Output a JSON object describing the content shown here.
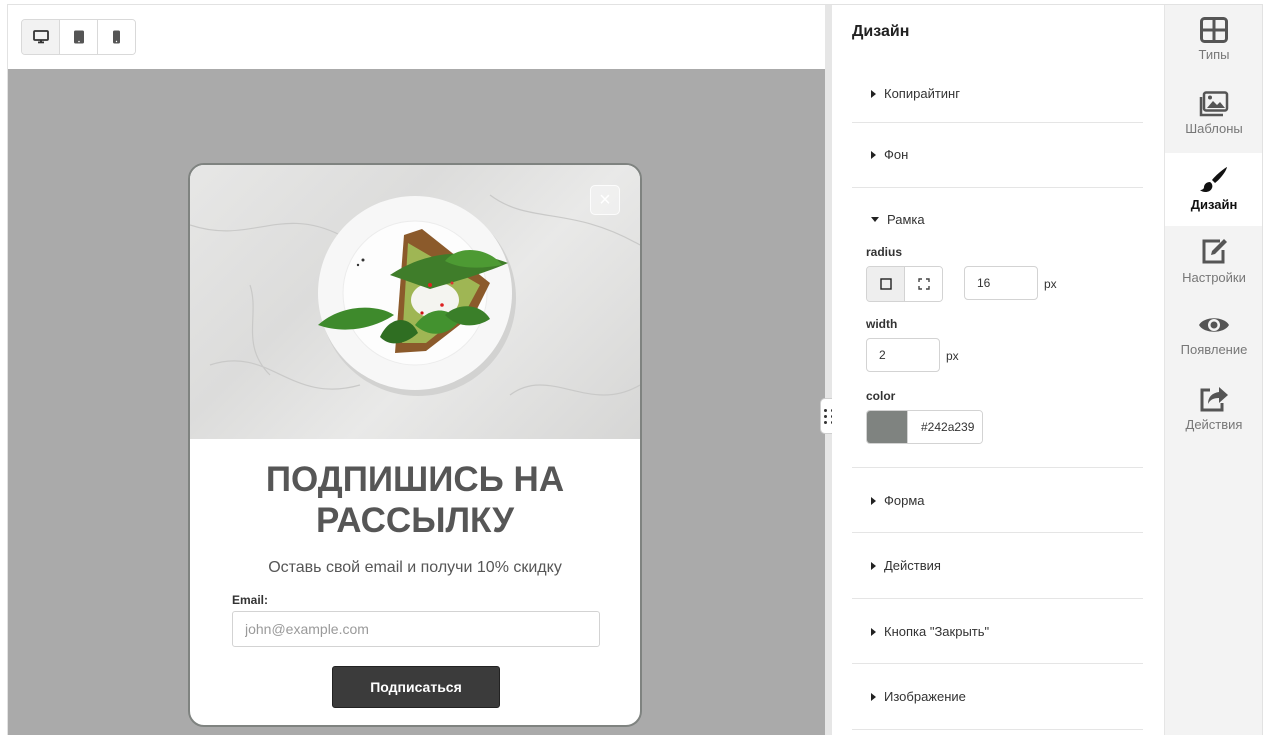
{
  "preview": {
    "devices": [
      {
        "name": "desktop-icon",
        "active": true
      },
      {
        "name": "tablet-icon",
        "active": false
      },
      {
        "name": "mobile-icon",
        "active": false
      }
    ],
    "popup": {
      "title": "ПОДПИШИСЬ НА РАССЫЛКУ",
      "subtitle": "Оставь свой email и получи 10% скидку",
      "email_label": "Email:",
      "email_placeholder": "john@example.com",
      "button_label": "Подписаться",
      "close_symbol": "×"
    }
  },
  "panel": {
    "title": "Дизайн",
    "sections": {
      "copywriting": "Копирайтинг",
      "background": "Фон",
      "frame": "Рамка",
      "form": "Форма",
      "actions": "Действия",
      "close_button": "Кнопка \"Закрыть\"",
      "image": "Изображение"
    },
    "frame": {
      "radius_label": "radius",
      "radius_value": "16",
      "radius_unit": "px",
      "width_label": "width",
      "width_value": "2",
      "width_unit": "px",
      "color_label": "color",
      "color_value": "#242a239",
      "swatch_color": "#7f8380"
    }
  },
  "nav": {
    "items": [
      {
        "label": "Типы",
        "icon": "grid-icon",
        "active": false
      },
      {
        "label": "Шаблоны",
        "icon": "images-icon",
        "active": false
      },
      {
        "label": "Дизайн",
        "icon": "brush-icon",
        "active": true
      },
      {
        "label": "Настройки",
        "icon": "edit-icon",
        "active": false
      },
      {
        "label": "Появление",
        "icon": "eye-icon",
        "active": false
      },
      {
        "label": "Действия",
        "icon": "share-icon",
        "active": false
      }
    ]
  }
}
